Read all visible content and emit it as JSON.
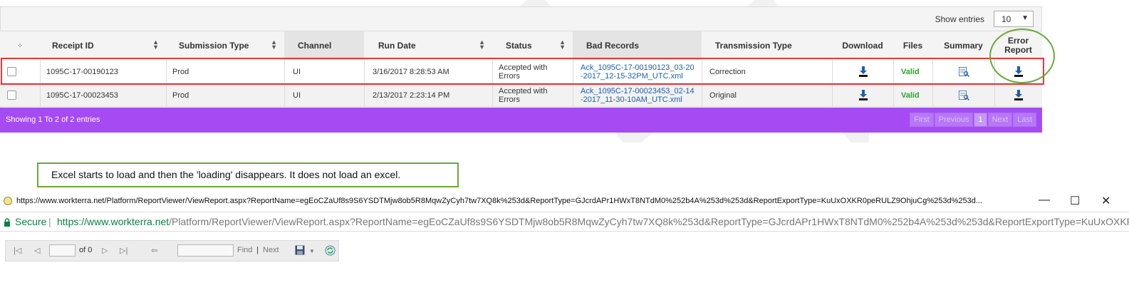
{
  "top_bar": {
    "show_entries_label": "Show entries",
    "page_size": "10"
  },
  "table": {
    "columns": [
      "Receipt ID",
      "Submission Type",
      "Channel",
      "Run Date",
      "Status",
      "Bad Records",
      "Transmission Type",
      "Download",
      "Files",
      "Summary",
      "Error\nReport"
    ],
    "rows": [
      {
        "receipt_id": "1095C-17-00190123",
        "submission_type": "Prod",
        "channel": "UI",
        "run_date": "3/16/2017 8:28:53 AM",
        "status": "Accepted with Errors",
        "bad_records": "Ack_1095C-17-00190123_03-20-2017_12-15-32PM_UTC.xml",
        "transmission_type": "Correction",
        "files": "Valid"
      },
      {
        "receipt_id": "1095C-17-00023453",
        "submission_type": "Prod",
        "channel": "UI",
        "run_date": "2/13/2017 2:23:14 PM",
        "status": "Accepted with Errors",
        "bad_records": "Ack_1095C-17-00023453_02-14-2017_11-30-10AM_UTC.xml",
        "transmission_type": "Original",
        "files": "Valid"
      }
    ]
  },
  "footer": {
    "info": "Showing 1 To 2 of 2 entries",
    "pager": {
      "first": "First",
      "previous": "Previous",
      "current": "1",
      "next": "Next",
      "last": "Last"
    }
  },
  "annotation": {
    "callout_text": "Excel starts to load and then the 'loading' disappears. It does not load an excel."
  },
  "browser": {
    "title_url": "https://www.workterra.net/Platform/ReportViewer/ViewReport.aspx?ReportName=egEoCZaUf8s9S6YSDTMjw8ob5R8MqwZyCyh7tw7XQ8k%253d&ReportType=GJcrdAPr1HWxT8NTdM0%252b4A%253d%253d&ReportExportType=KuUxOXKR0peRULZ9OhjuCg%253d%253d...",
    "secure_label": "Secure",
    "host": "https://www.workterra.net",
    "path": "/Platform/ReportViewer/ViewReport.aspx?ReportName=egEoCZaUf8s9S6YSDTMjw8ob5R8MqwZyCyh7tw7XQ8k%253d&ReportType=GJcrdAPr1HWxT8NTdM0%252b4A%253d%253d&ReportExportType=KuUxOXKR0pe"
  },
  "report_toolbar": {
    "page_of": "of 0",
    "find_label": "Find",
    "separator": "|",
    "next_label": "Next"
  },
  "colors": {
    "footer_bg": "#a64bf4",
    "link": "#1a5fb4",
    "valid": "#2aa52a",
    "highlight_red": "#e23b3b",
    "highlight_green": "#6aa83a"
  }
}
